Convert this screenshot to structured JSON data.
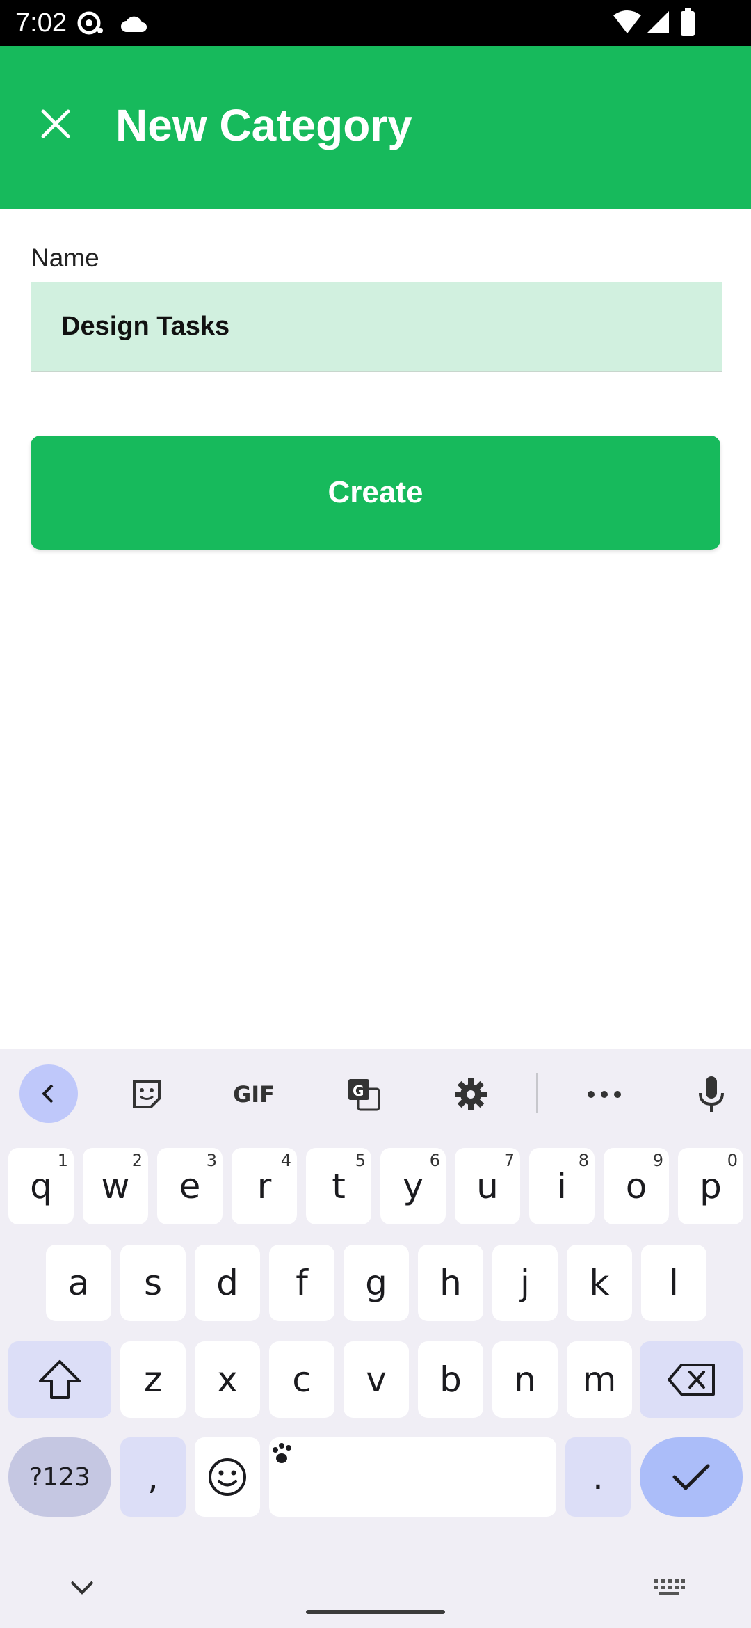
{
  "status_bar": {
    "time": "7:02",
    "icons": [
      "podcast-icon",
      "cloud-icon",
      "wifi-icon",
      "signal-icon",
      "battery-icon"
    ]
  },
  "app_bar": {
    "title": "New Category",
    "close_icon": "close-icon",
    "color": "#17BA5C"
  },
  "form": {
    "name_label": "Name",
    "name_value": "Design Tasks",
    "field_color": "#D1F0DF",
    "create_label": "Create"
  },
  "keyboard": {
    "toolbar": [
      "back-icon",
      "sticker-icon",
      "GIF",
      "translate-icon",
      "settings-icon",
      "more-icon",
      "mic-icon"
    ],
    "gif_label": "GIF",
    "row1": [
      {
        "key": "q",
        "hint": "1"
      },
      {
        "key": "w",
        "hint": "2"
      },
      {
        "key": "e",
        "hint": "3"
      },
      {
        "key": "r",
        "hint": "4"
      },
      {
        "key": "t",
        "hint": "5"
      },
      {
        "key": "y",
        "hint": "6"
      },
      {
        "key": "u",
        "hint": "7"
      },
      {
        "key": "i",
        "hint": "8"
      },
      {
        "key": "o",
        "hint": "9"
      },
      {
        "key": "p",
        "hint": "0"
      }
    ],
    "row2": [
      "a",
      "s",
      "d",
      "f",
      "g",
      "h",
      "j",
      "k",
      "l"
    ],
    "row3": [
      "z",
      "x",
      "c",
      "v",
      "b",
      "n",
      "m"
    ],
    "mode_label": "?123",
    "comma": ",",
    "period": ".",
    "accent_color": "#ABBDF9"
  }
}
